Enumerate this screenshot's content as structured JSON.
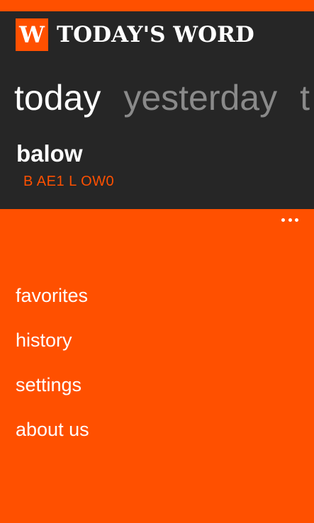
{
  "colors": {
    "accent": "#ff5000",
    "background": "#262626",
    "text": "#ffffff",
    "inactive_pivot": "#8a8a8a"
  },
  "app": {
    "logo_letter": "W",
    "title": "TODAY'S WORD"
  },
  "pivots": [
    {
      "label": "today"
    },
    {
      "label": "yesterday"
    },
    {
      "label": "t"
    }
  ],
  "entry": {
    "word": "balow",
    "pronunciation": "B AE1 L OW0"
  },
  "app_bar": {
    "more_icon": "ellipsis-icon",
    "menu_items": [
      {
        "label": "favorites"
      },
      {
        "label": "history"
      },
      {
        "label": "settings"
      },
      {
        "label": "about us"
      }
    ]
  }
}
